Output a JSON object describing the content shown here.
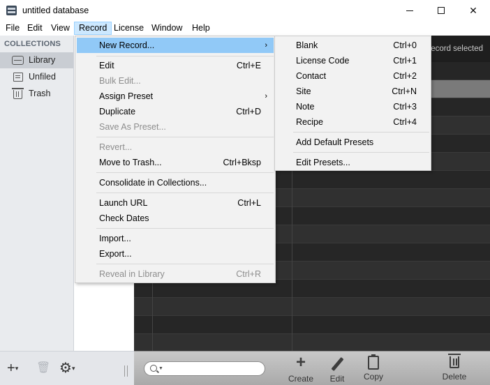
{
  "window": {
    "title": "untitled database",
    "minimize_label": "",
    "close_label": "✕"
  },
  "menubar": [
    "File",
    "Edit",
    "View",
    "Record",
    "License",
    "Window",
    "Help"
  ],
  "sidebar": {
    "header": "COLLECTIONS",
    "items": [
      {
        "label": "Library",
        "icon": "inbox-icon",
        "selected": true
      },
      {
        "label": "Unfiled",
        "icon": "document-icon",
        "selected": false
      },
      {
        "label": "Trash",
        "icon": "trash-icon",
        "selected": false
      }
    ],
    "footer": {
      "add": "+",
      "caret": "▾",
      "delete": "🗑",
      "gear": "⚙"
    }
  },
  "main": {
    "record_status": "ecord selected"
  },
  "toolbar": {
    "search_placeholder": "",
    "create_label": "Create",
    "create_glyph": "+",
    "edit_label": "Edit",
    "copy_label": "Copy",
    "delete_label": "Delete"
  },
  "record_menu": {
    "items": [
      {
        "label": "New Record...",
        "shortcut": "",
        "submenu": true,
        "highlight": true
      },
      {
        "label": "Edit",
        "shortcut": "Ctrl+E"
      },
      {
        "label": "Bulk Edit...",
        "shortcut": "",
        "disabled": true
      },
      {
        "label": "Assign Preset",
        "shortcut": "",
        "submenu": true
      },
      {
        "label": "Duplicate",
        "shortcut": "Ctrl+D"
      },
      {
        "label": "Save As Preset...",
        "shortcut": "",
        "disabled": true
      },
      {
        "label": "Revert...",
        "shortcut": "",
        "disabled": true
      },
      {
        "label": "Move to Trash...",
        "shortcut": "Ctrl+Bksp"
      },
      {
        "label": "Consolidate in Collections...",
        "shortcut": ""
      },
      {
        "label": "Launch URL",
        "shortcut": "Ctrl+L"
      },
      {
        "label": "Check Dates",
        "shortcut": ""
      },
      {
        "label": "Import...",
        "shortcut": ""
      },
      {
        "label": "Export...",
        "shortcut": ""
      },
      {
        "label": "Reveal in Library",
        "shortcut": "Ctrl+R",
        "disabled": true
      }
    ],
    "submenu_arrow": "›"
  },
  "new_record_submenu": {
    "items": [
      {
        "label": "Blank",
        "shortcut": "Ctrl+0"
      },
      {
        "label": "License Code",
        "shortcut": "Ctrl+1"
      },
      {
        "label": "Contact",
        "shortcut": "Ctrl+2"
      },
      {
        "label": "Site",
        "shortcut": "Ctrl+N"
      },
      {
        "label": "Note",
        "shortcut": "Ctrl+3"
      },
      {
        "label": "Recipe",
        "shortcut": "Ctrl+4"
      },
      {
        "label": "Add Default Presets",
        "shortcut": ""
      },
      {
        "label": "Edit Presets...",
        "shortcut": ""
      }
    ]
  }
}
